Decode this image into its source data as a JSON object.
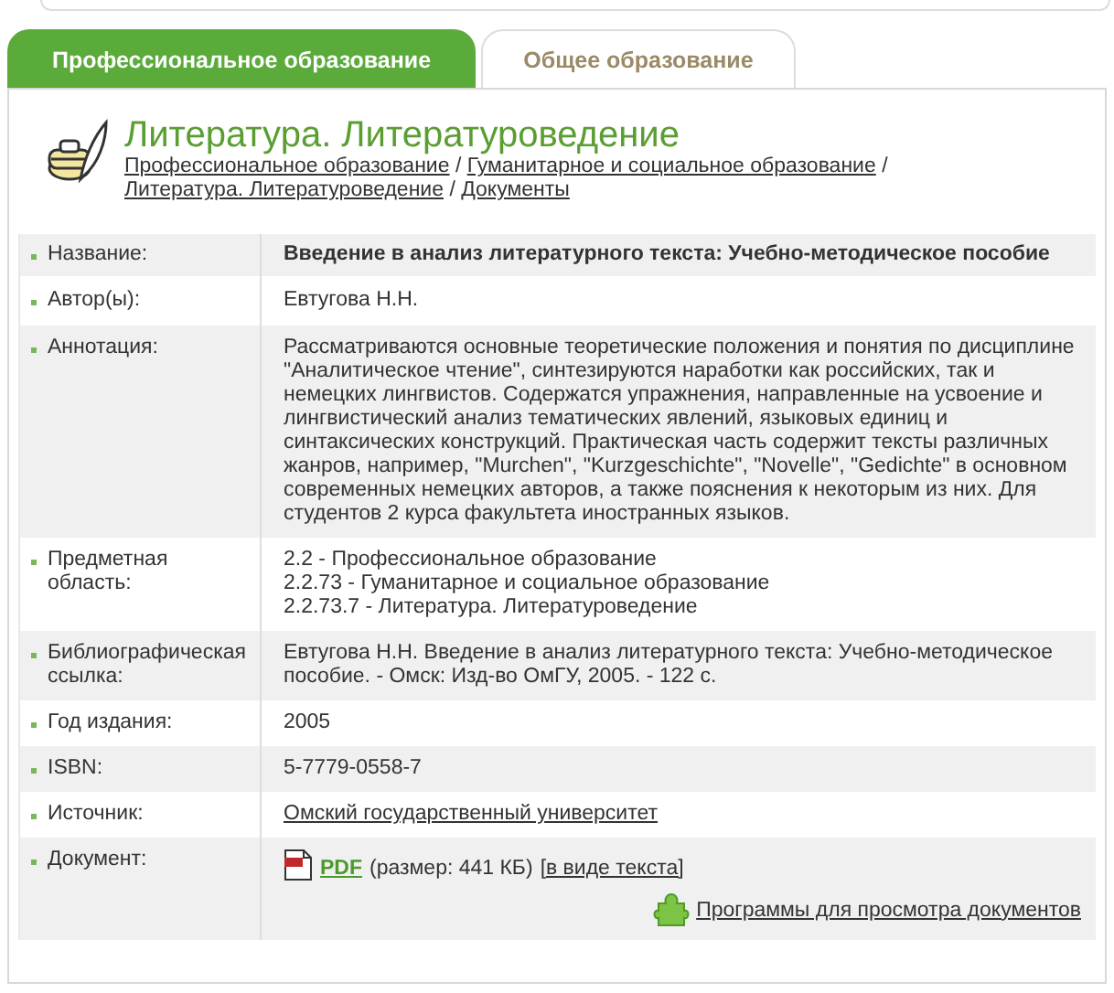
{
  "tabs": [
    {
      "label": "Профессиональное образование",
      "selected": true
    },
    {
      "label": "Общее образование",
      "selected": false
    }
  ],
  "section": {
    "title": "Литература. Литературоведение",
    "breadcrumb_separator": "/",
    "breadcrumbs": [
      "Профессиональное образование",
      "Гуманитарное и социальное образование",
      "Литература. Литературоведение",
      "Документы"
    ]
  },
  "rows": [
    {
      "label": "Название:",
      "kind": "bold",
      "value": "Введение в анализ литературного текста: Учебно-методическое пособие"
    },
    {
      "label": "Автор(ы):",
      "kind": "text",
      "value": "Евтугова Н.Н."
    },
    {
      "label": "Аннотация:",
      "kind": "text",
      "value": "Рассматриваются основные теоретические положения и понятия по дисциплине \"Аналитическое чтение\", синтезируются наработки как российских, так и немецких лингвистов. Содержатся упражнения, направленные на усвоение и лингвистический анализ тематических явлений, языковых единиц и синтаксических конструкций. Практическая часть содержит тексты различных жанров, например, \"Murchen\", \"Kurzgeschichte\", \"Novelle\", \"Gedichte\" в основном современных немецких авторов, а также пояснения к некоторым из них. Для студентов 2 курса факультета иностранных языков."
    },
    {
      "label": "Предметная область:",
      "kind": "lines",
      "lines": [
        "2.2 - Профессиональное образование",
        "2.2.73 - Гуманитарное и социальное образование",
        "2.2.73.7 - Литература. Литературоведение"
      ]
    },
    {
      "label": "Библиографическая ссылка:",
      "kind": "text",
      "value": "Евтугова Н.Н. Введение в анализ литературного текста: Учебно-методическое пособие. - Омск: Изд-во ОмГУ, 2005. - 122 с."
    },
    {
      "label": "Год издания:",
      "kind": "text",
      "value": "2005"
    },
    {
      "label": "ISBN:",
      "kind": "text",
      "value": "5-7779-0558-7"
    },
    {
      "label": "Источник:",
      "kind": "link",
      "value": "Омский государственный университет"
    },
    {
      "label": "Документ:",
      "kind": "document",
      "format": "PDF",
      "size": "(размер: 441 КБ)",
      "text_link": "[в виде текста]",
      "viewers_link": "Программы для просмотра документов"
    }
  ]
}
